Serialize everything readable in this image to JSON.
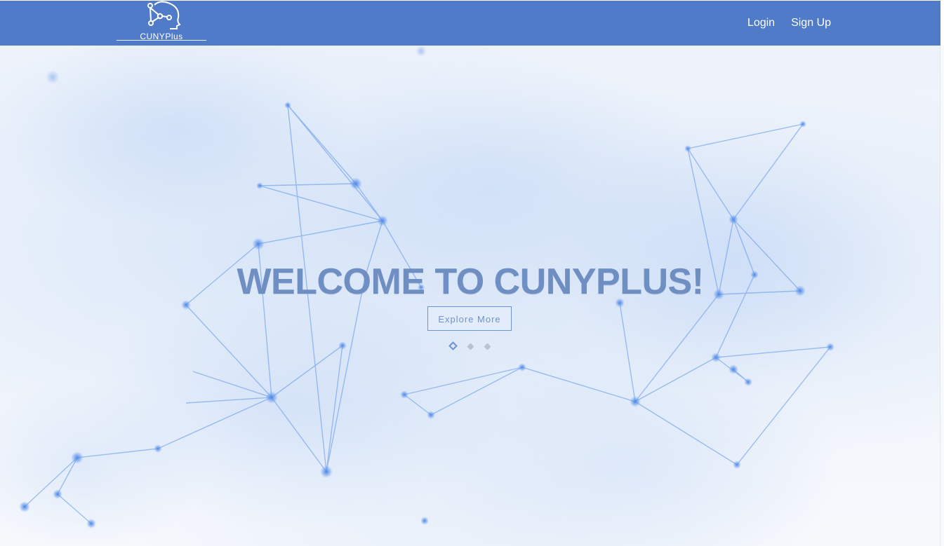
{
  "navbar": {
    "logo_text": "CUNYPlus",
    "links": [
      {
        "label": "Login"
      },
      {
        "label": "Sign Up"
      }
    ],
    "background_color": "#4f7bc9"
  },
  "hero": {
    "title": "WELCOME TO CUNYPLUS!",
    "cta_label": "Explore More",
    "carousel_indicators": [
      "active",
      "inactive",
      "inactive"
    ],
    "accent_color": "#6c93d4"
  }
}
